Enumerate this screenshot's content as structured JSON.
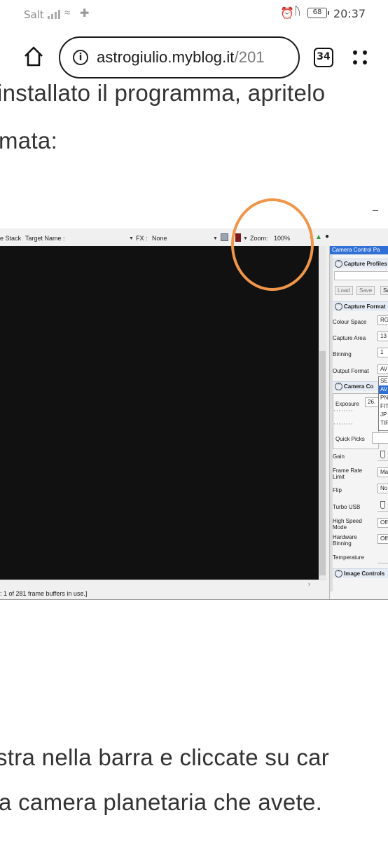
{
  "status_bar": {
    "carrier": "Salt",
    "battery": "68",
    "time": "20:37"
  },
  "browser": {
    "url_host": "astrogiulio.myblog.it",
    "url_path": "/201",
    "tab_count": "34"
  },
  "article": {
    "line1": "installato il programma, apritelo",
    "line2": "mata:",
    "line3": "stra nella barra e cliccate su car",
    "line4": "a camera planetaria che avete."
  },
  "capture_app": {
    "toolbar": {
      "stack_label": "e Stack",
      "target_name_label": "Target Name :",
      "fx_label": "FX :",
      "fx_value": "None",
      "zoom_label": "Zoom:",
      "zoom_value": "100%"
    },
    "status_text": ": 1 of 281 frame buffers in use.]",
    "panel": {
      "title": "Camera Control Pa",
      "sections": {
        "capture_profiles": "Capture Profiles",
        "capture_format": "Capture Format",
        "camera_controls": "Camera Co",
        "image_controls": "Image Controls"
      },
      "buttons": {
        "load": "Load",
        "save": "Save",
        "save_as": "Sa"
      },
      "labels": {
        "colour_space": "Colour Space",
        "capture_area": "Capture Area",
        "binning": "Binning",
        "output_format": "Output Format",
        "exposure": "Exposure",
        "quick_picks": "Quick Picks",
        "gain": "Gain",
        "frame_rate_limit_1": "Frame Rate",
        "frame_rate_limit_2": "Limit",
        "flip": "Flip",
        "turbo_usb": "Turbo USB",
        "high_speed_mode_1": "High Speed",
        "high_speed_mode_2": "Mode",
        "hardware_binning_1": "Hardware",
        "hardware_binning_2": "Binning",
        "temperature": "Temperature"
      },
      "values": {
        "colour_space": "RG",
        "capture_area": "13",
        "binning": "1",
        "output_format": "AV",
        "exposure": "26.",
        "frame_rate_limit": "Ma",
        "flip": "No",
        "high_speed_mode": "Off",
        "hardware_binning": "Off"
      },
      "output_format_options": [
        "SE",
        "AV",
        "PN",
        "FIT",
        "JP",
        "TIF"
      ]
    }
  },
  "colors": {
    "annotation_circle": "#f0964a",
    "panel_title_bg": "#2f6fd6",
    "canvas_bg": "#111111"
  }
}
